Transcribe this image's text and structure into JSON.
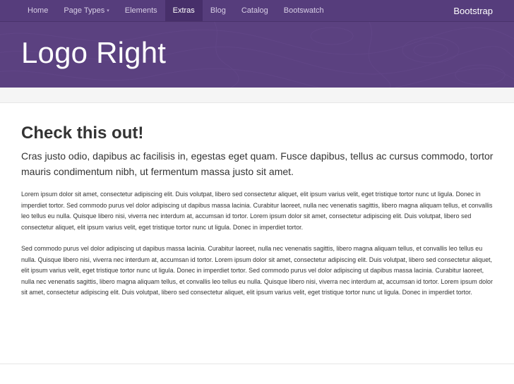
{
  "navbar": {
    "items": [
      {
        "label": "Home"
      },
      {
        "label": "Page Types",
        "has_dropdown": true
      },
      {
        "label": "Elements"
      },
      {
        "label": "Extras",
        "active": true
      },
      {
        "label": "Blog"
      },
      {
        "label": "Catalog"
      },
      {
        "label": "Bootswatch"
      }
    ],
    "caret_glyph": "▾",
    "brand": "Bootstrap"
  },
  "masthead": {
    "title": "Logo Right"
  },
  "main": {
    "heading": "Check this out!",
    "lead": "Cras justo odio, dapibus ac facilisis in, egestas eget quam. Fusce dapibus, tellus ac cursus commodo, tortor mauris condimentum nibh, ut fermentum massa justo sit amet.",
    "paragraphs": [
      "Lorem ipsum dolor sit amet, consectetur adipiscing elit. Duis volutpat, libero sed consectetur aliquet, elit ipsum varius velit, eget tristique tortor nunc ut ligula. Donec in imperdiet tortor. Sed commodo purus vel dolor adipiscing ut dapibus massa lacinia. Curabitur laoreet, nulla nec venenatis sagittis, libero magna aliquam tellus, et convallis leo tellus eu nulla. Quisque libero nisi, viverra nec interdum at, accumsan id tortor. Lorem ipsum dolor sit amet, consectetur adipiscing elit. Duis volutpat, libero sed consectetur aliquet, elit ipsum varius velit, eget tristique tortor nunc ut ligula. Donec in imperdiet tortor.",
      "Sed commodo purus vel dolor adipiscing ut dapibus massa lacinia. Curabitur laoreet, nulla nec venenatis sagittis, libero magna aliquam tellus, et convallis leo tellus eu nulla. Quisque libero nisi, viverra nec interdum at, accumsan id tortor. Lorem ipsum dolor sit amet, consectetur adipiscing elit. Duis volutpat, libero sed consectetur aliquet, elit ipsum varius velit, eget tristique tortor nunc ut ligula. Donec in imperdiet tortor. Sed commodo purus vel dolor adipiscing ut dapibus massa lacinia. Curabitur laoreet, nulla nec venenatis sagittis, libero magna aliquam tellus, et convallis leo tellus eu nulla. Quisque libero nisi, viverra nec interdum at, accumsan id tortor. Lorem ipsum dolor sit amet, consectetur adipiscing elit. Duis volutpat, libero sed consectetur aliquet, elit ipsum varius velit, eget tristique tortor nunc ut ligula. Donec in imperdiet tortor."
    ]
  },
  "colors": {
    "navbar_bg": "#563d7c",
    "navbar_active_bg": "#472f6a",
    "masthead_bg": "#5b4180",
    "text": "#333333"
  }
}
